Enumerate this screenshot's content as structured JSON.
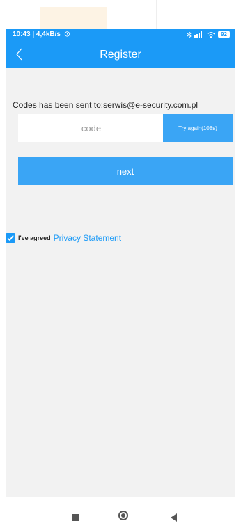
{
  "status_bar": {
    "time_speed": "10:43 | 4,4kB/s",
    "battery": "92"
  },
  "nav_bar": {
    "title": "Register"
  },
  "register": {
    "sent_message": "Codes has been sent to:serwis@e-security.com.pl",
    "code_placeholder": "code",
    "code_value": "",
    "retry_label": "Try again(108s)",
    "next_label": "next"
  },
  "agreement": {
    "checked": true,
    "agreed_text": "I've agreed",
    "link_text": "Privacy Statement"
  },
  "colors": {
    "accent": "#1b9af7",
    "button": "#3aa5f5",
    "background": "#f2f2f2"
  },
  "icons": {
    "back": "chevron-left-icon",
    "alarm": "alarm-clock-icon",
    "bluetooth": "bluetooth-icon",
    "signal": "signal-icon",
    "wifi": "wifi-icon",
    "checkbox": "checkmark-icon"
  }
}
